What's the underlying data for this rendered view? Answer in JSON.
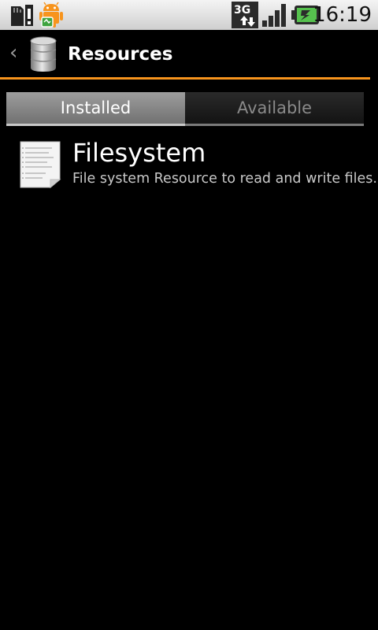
{
  "status_bar": {
    "network_label": "3G",
    "clock": "16:19",
    "icons": [
      "sd-card-icon",
      "android-debug-icon",
      "network-3g-icon",
      "signal-icon",
      "battery-charging-icon"
    ]
  },
  "header": {
    "back_icon": "chevron-left-icon",
    "app_icon": "database-icon",
    "title": "Resources",
    "accent_color": "#f7941d"
  },
  "tabs": [
    {
      "label": "Installed",
      "selected": true
    },
    {
      "label": "Available",
      "selected": false
    }
  ],
  "list": [
    {
      "icon": "document-icon",
      "title": "Filesystem",
      "description": "File system Resource to read and write files."
    }
  ]
}
